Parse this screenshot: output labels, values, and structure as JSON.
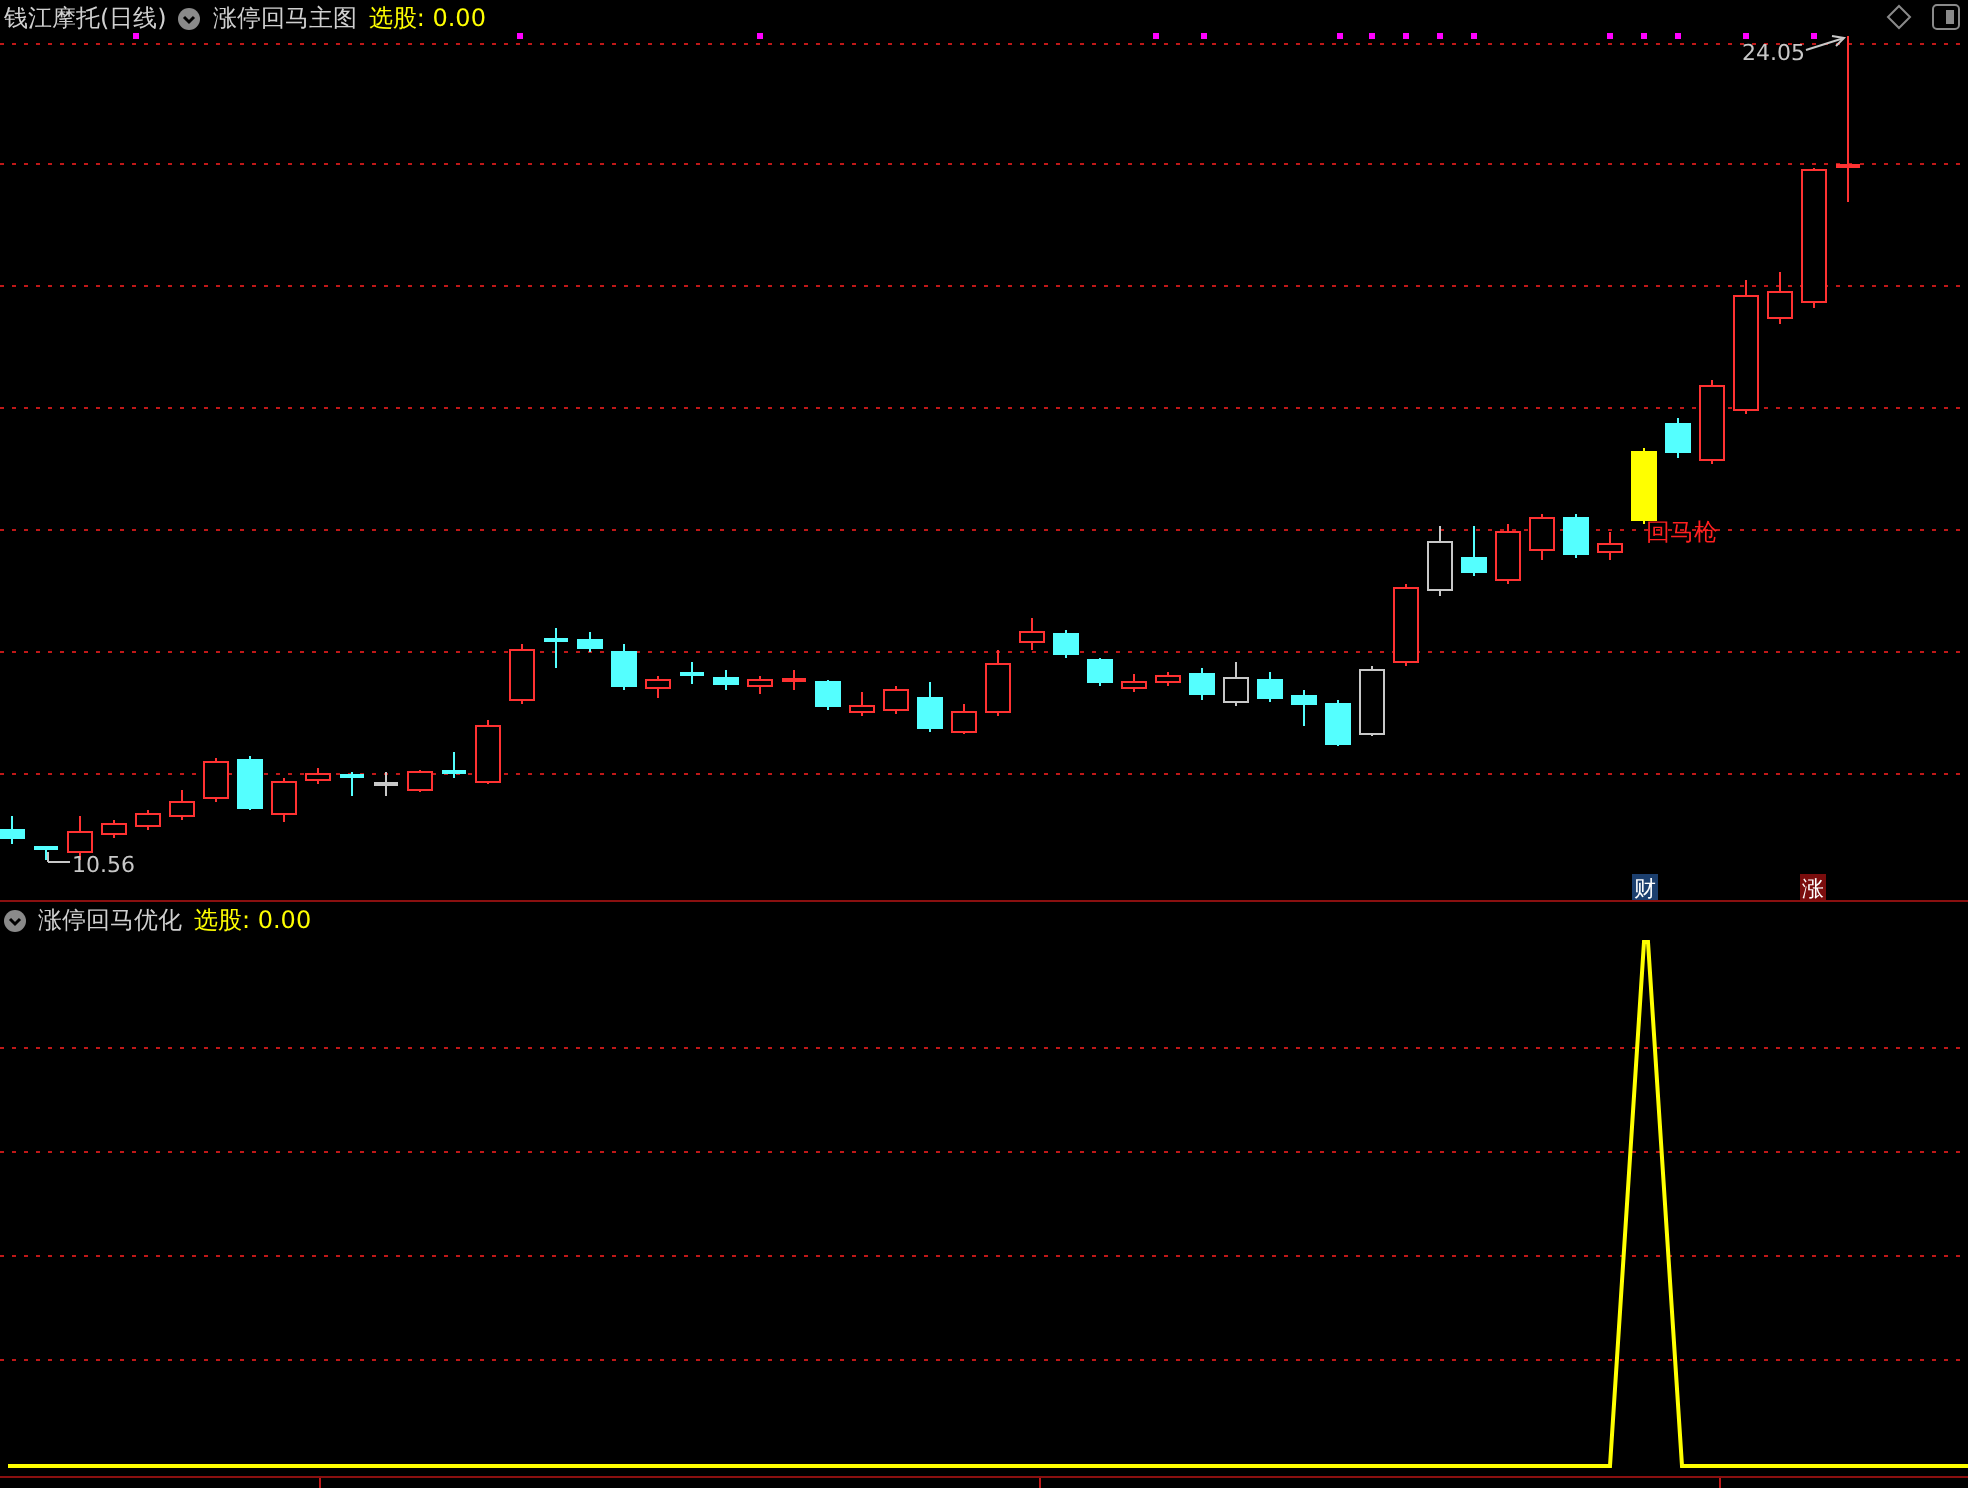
{
  "main_pane": {
    "title": "钱江摩托(日线)",
    "indicator": "涨停回马主图",
    "select_text": "选股: 0.00",
    "high_label": "24.05",
    "low_label": "10.56",
    "signal_label": "回马枪",
    "markers": [
      {
        "text": "财",
        "color": "#1c3f6e"
      },
      {
        "text": "涨",
        "color": "#7a0d0d"
      }
    ]
  },
  "sub_pane": {
    "indicator": "涨停回马优化",
    "select_text": "选股: 0.00"
  }
}
